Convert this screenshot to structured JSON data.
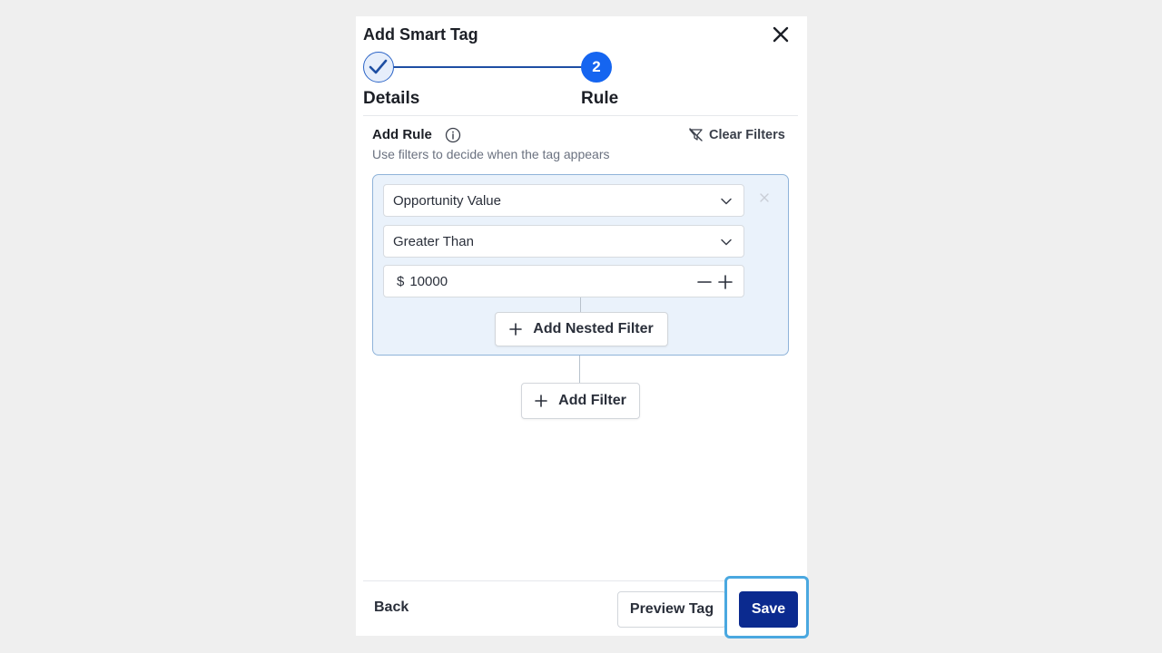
{
  "modal": {
    "title": "Add Smart Tag"
  },
  "stepper": {
    "steps": [
      {
        "label": "Details",
        "state": "completed"
      },
      {
        "label": "Rule",
        "number": "2",
        "state": "active"
      }
    ]
  },
  "rule": {
    "heading": "Add Rule",
    "description": "Use filters to decide when the tag appears",
    "clear_filters_label": "Clear Filters"
  },
  "filter": {
    "field": "Opportunity Value",
    "operator": "Greater Than",
    "currency_symbol": "$",
    "value": "10000",
    "add_nested_label": "Add Nested Filter"
  },
  "add_filter_label": "Add Filter",
  "footer": {
    "back_label": "Back",
    "preview_label": "Preview Tag",
    "save_label": "Save"
  },
  "colors": {
    "primary": "#1565f0",
    "save": "#0b2a8f",
    "filter_bg": "#eaf2fb",
    "focus_ring": "#4aa8e0"
  }
}
